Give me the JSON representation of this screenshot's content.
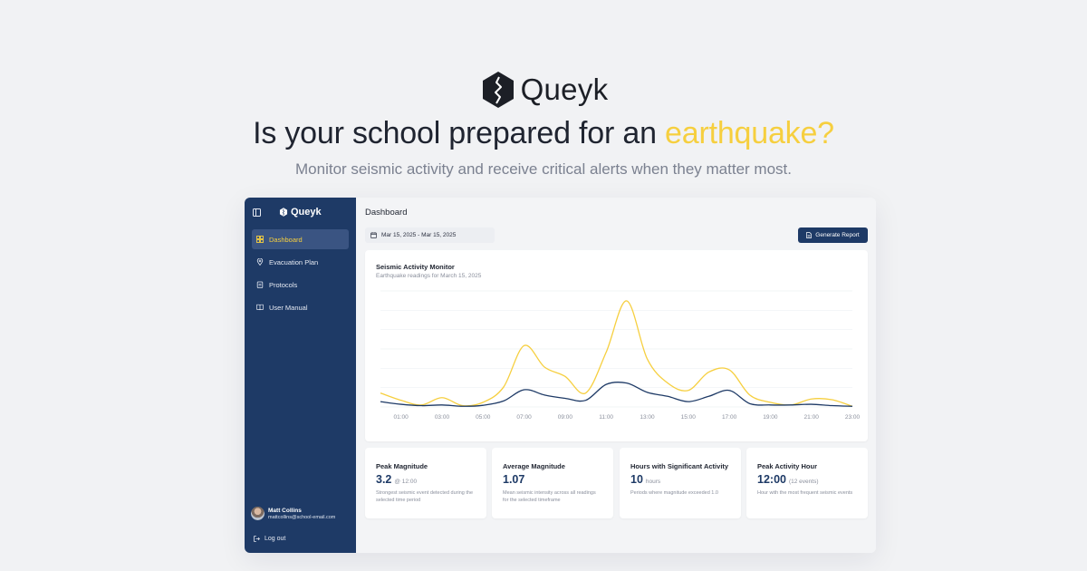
{
  "hero": {
    "brand": "Queyk",
    "headline_prefix": "Is your school prepared for an ",
    "headline_accent": "earthquake?",
    "subheadline": "Monitor seismic activity and receive critical alerts when they matter most."
  },
  "colors": {
    "accent": "#f6cf3f",
    "navy": "#1e3a66",
    "sidebar_active_bg": "#3a5482",
    "background": "#f1f2f4"
  },
  "sidebar": {
    "brand": "Queyk",
    "items": [
      {
        "label": "Dashboard",
        "icon": "dashboard-icon",
        "active": true
      },
      {
        "label": "Evacuation Plan",
        "icon": "map-pin-icon",
        "active": false
      },
      {
        "label": "Protocols",
        "icon": "clipboard-icon",
        "active": false
      },
      {
        "label": "User Manual",
        "icon": "book-icon",
        "active": false
      }
    ],
    "user": {
      "name": "Matt Collins",
      "email": "mattcollins@school-email.com"
    },
    "logout_label": "Log out"
  },
  "main": {
    "title": "Dashboard",
    "date_range": "Mar 15, 2025 - Mar 15, 2025",
    "generate_report_label": "Generate Report"
  },
  "chart_data": {
    "type": "line",
    "title": "Seismic Activity Monitor",
    "subtitle": "Earthquake readings for March 15, 2025",
    "x": [
      "00:00",
      "01:00",
      "02:00",
      "03:00",
      "04:00",
      "05:00",
      "06:00",
      "07:00",
      "08:00",
      "09:00",
      "10:00",
      "11:00",
      "12:00",
      "13:00",
      "14:00",
      "15:00",
      "16:00",
      "17:00",
      "18:00",
      "19:00",
      "20:00",
      "21:00",
      "22:00",
      "23:00"
    ],
    "tick_labels": [
      "01:00",
      "03:00",
      "05:00",
      "07:00",
      "09:00",
      "11:00",
      "13:00",
      "15:00",
      "17:00",
      "19:00",
      "21:00",
      "23:00"
    ],
    "ylim": [
      0,
      3.5
    ],
    "grid": true,
    "legend": "none",
    "series": [
      {
        "color": "#f6cf3f",
        "values": [
          0.42,
          0.2,
          0.06,
          0.28,
          0.04,
          0.14,
          0.6,
          1.85,
          1.2,
          0.92,
          0.42,
          1.65,
          3.2,
          1.45,
          0.72,
          0.5,
          1.05,
          1.12,
          0.36,
          0.14,
          0.06,
          0.24,
          0.22,
          0.02
        ]
      },
      {
        "color": "#1e3a66",
        "values": [
          0.16,
          0.08,
          0.04,
          0.06,
          0.02,
          0.05,
          0.18,
          0.52,
          0.36,
          0.26,
          0.2,
          0.68,
          0.72,
          0.44,
          0.32,
          0.16,
          0.32,
          0.5,
          0.1,
          0.06,
          0.06,
          0.08,
          0.04,
          0.02
        ]
      }
    ]
  },
  "stats": [
    {
      "title": "Peak Magnitude",
      "value": "3.2",
      "suffix": "@ 12:00",
      "description": "Strongest seismic event detected during the selected time period"
    },
    {
      "title": "Average Magnitude",
      "value": "1.07",
      "suffix": "",
      "description": "Mean seismic intensity across all readings for the selected timeframe"
    },
    {
      "title": "Hours with Significant Activity",
      "value": "10",
      "suffix": "hours",
      "description": "Periods where magnitude exceeded 1.0"
    },
    {
      "title": "Peak Activity Hour",
      "value": "12:00",
      "suffix": "(12 events)",
      "description": "Hour with the most frequent seismic events"
    }
  ]
}
